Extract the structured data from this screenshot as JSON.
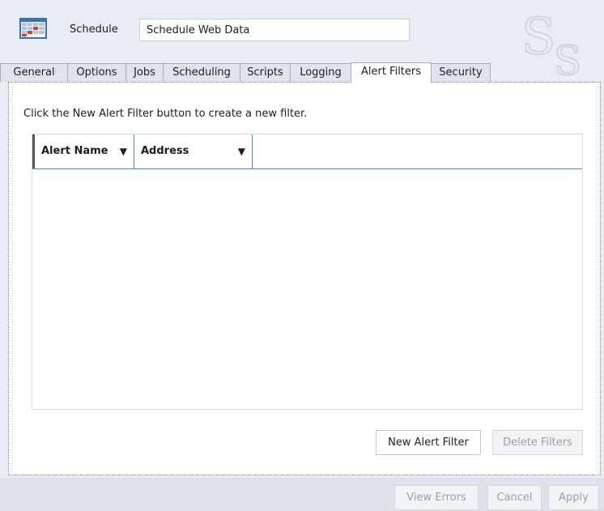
{
  "header": {
    "label": "Schedule",
    "name_value": "Schedule Web Data"
  },
  "tabs": [
    {
      "label": "General"
    },
    {
      "label": "Options"
    },
    {
      "label": "Jobs"
    },
    {
      "label": "Scheduling"
    },
    {
      "label": "Scripts"
    },
    {
      "label": "Logging"
    },
    {
      "label": "Alert Filters",
      "active": true
    },
    {
      "label": "Security"
    }
  ],
  "alert_filters": {
    "hint": "Click the New Alert Filter button to create a new filter.",
    "columns": [
      {
        "label": "Alert Name"
      },
      {
        "label": "Address"
      }
    ],
    "rows": [],
    "new_button": "New Alert Filter",
    "delete_button": "Delete Filters"
  },
  "footer": {
    "view_errors": "View Errors",
    "cancel": "Cancel",
    "apply": "Apply"
  },
  "colors": {
    "accent": "#3c8fd6",
    "background": "#e8ecf3",
    "icon_red": "#d0452f"
  },
  "icons": [
    "calendar-grid-icon",
    "filter-icon",
    "logo-watermark-icon"
  ]
}
